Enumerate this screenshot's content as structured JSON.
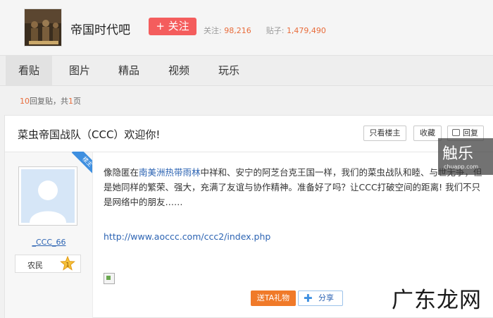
{
  "forum": {
    "name": "帝国时代吧",
    "follow_label": "+ 关注",
    "followers_label": "关注:",
    "followers_value": "98,216",
    "posts_label": "贴子:",
    "posts_value": "1,479,490"
  },
  "nav": {
    "tabs": [
      {
        "label": "看贴"
      },
      {
        "label": "图片"
      },
      {
        "label": "精品"
      },
      {
        "label": "视频"
      },
      {
        "label": "玩乐"
      }
    ]
  },
  "thread_meta": {
    "reply_count": "10",
    "reply_suffix": "回复贴，共",
    "page_count": "1",
    "page_suffix": "页"
  },
  "thread": {
    "title": "菜虫帝国战队（CCC）欢迎你!",
    "only_op_label": "只看楼主",
    "favorite_label": "收藏",
    "reply_label": "回复"
  },
  "author": {
    "name": "_CCC_66",
    "level_title": "农民",
    "level_number": "1",
    "op_badge": "楼主"
  },
  "post": {
    "text_before": "像隐匿在",
    "keyword": "南美洲热带雨林",
    "text_after": "中祥和、安宁的阿芝台克王国一样，我们的菜虫战队和睦、与世无争，但是她同样的繁荣、强大，充满了友谊与协作精神。准备好了吗？让CCC打破空间的距离! 我们不只是网络中的朋友……",
    "link": "http://www.aoccc.com/ccc2/index.php",
    "gift_label": "送TA礼物",
    "share_label": "分享"
  },
  "watermarks": {
    "top_main": "触乐",
    "top_sub": "chuapp.com",
    "bottom": "广东龙网"
  },
  "colors": {
    "accent_orange": "#e86c3b",
    "follow_red": "#f45d5d",
    "link_blue": "#2d64b3",
    "gift_orange": "#f07a29"
  }
}
